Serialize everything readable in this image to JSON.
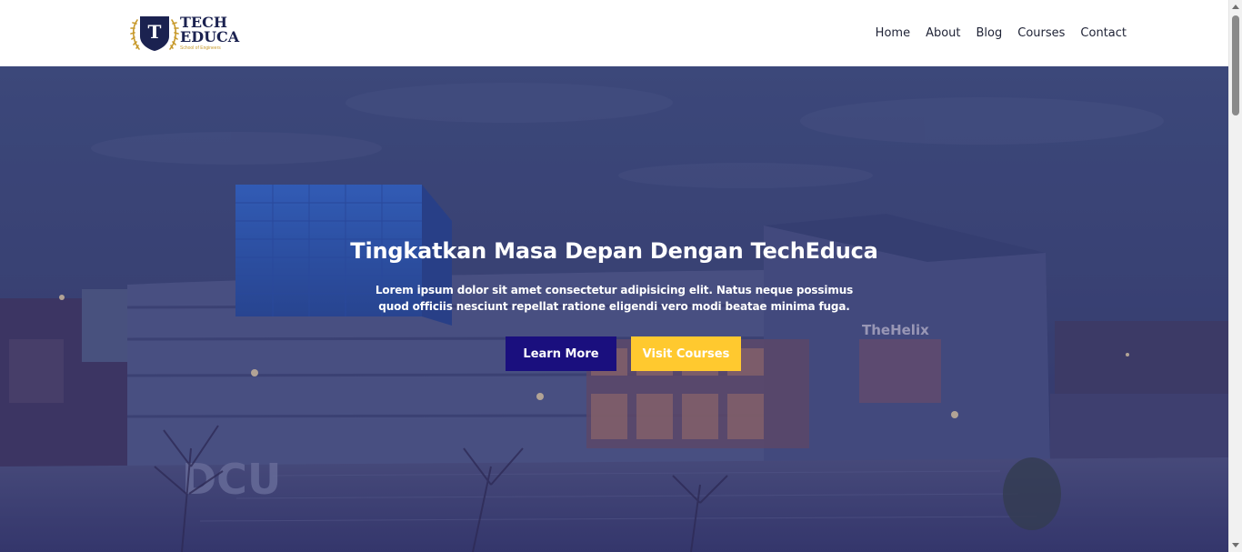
{
  "brand": {
    "name_line1": "TECH",
    "name_line2": "EDUCA",
    "tagline": "School of Engineers",
    "emblem_letter": "T",
    "colors": {
      "navy": "#1b2250",
      "gold": "#c89a2c"
    }
  },
  "nav": {
    "items": [
      {
        "label": "Home"
      },
      {
        "label": "About"
      },
      {
        "label": "Blog"
      },
      {
        "label": "Courses"
      },
      {
        "label": "Contact"
      }
    ]
  },
  "hero": {
    "title": "Tingkatkan Masa Depan Dengan TechEduca",
    "description": "Lorem ipsum dolor sit amet consectetur adipisicing elit. Natus neque possimus quod officiis nesciunt repellat ratione eligendi vero modi beatae minima fuga.",
    "primary_button": "Learn More",
    "secondary_button": "Visit Courses",
    "building_sign": "TheHelix",
    "ground_sign": "DCU",
    "colors": {
      "primary": "#1a0f7e",
      "secondary": "#ffc92f"
    }
  }
}
